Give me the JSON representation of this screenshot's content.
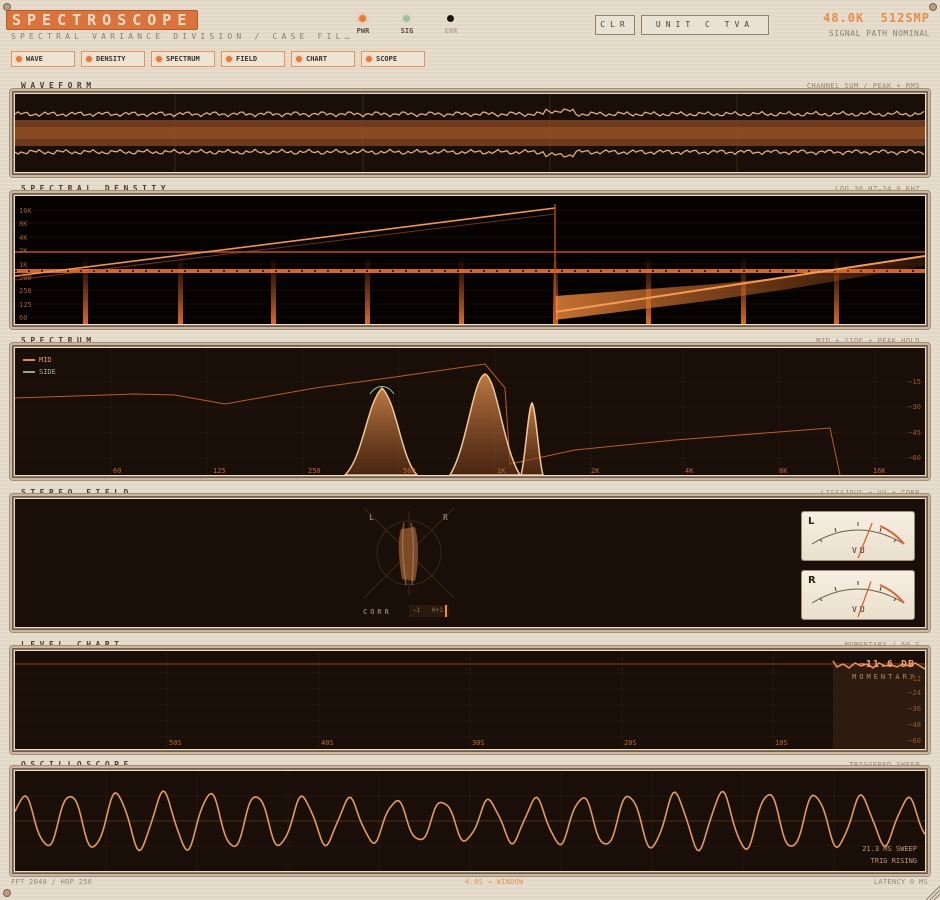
{
  "header": {
    "brand": "SPECTROSCOPE",
    "subtitle": "SPECTRAL VARIANCE DIVISION / CASE FIL…",
    "leds": [
      {
        "label": "PWR",
        "color": "#e87a3c"
      },
      {
        "label": "SIG",
        "color": "#9fc49a"
      },
      {
        "label": "ERR",
        "color": "#1a1410"
      }
    ],
    "clear_label": "CLR",
    "unit_label": "UNIT C TVA",
    "sample_rate": "48.0K",
    "buffer": "512SMP",
    "signal_path": "SIGNAL PATH NOMINAL"
  },
  "tabs": [
    {
      "label": "WAVE"
    },
    {
      "label": "DENSITY"
    },
    {
      "label": "SPECTRUM"
    },
    {
      "label": "FIELD"
    },
    {
      "label": "CHART"
    },
    {
      "label": "SCOPE"
    }
  ],
  "waveform": {
    "title": "WAVEFORM",
    "meta": "CHANNEL SUM / PEAK + RMS"
  },
  "density": {
    "title": "SPECTRAL DENSITY",
    "meta": "LOG 30 HZ–24.0 KHZ",
    "ylabels": [
      "16K",
      "8K",
      "4K",
      "2K",
      "1K",
      "500",
      "250",
      "125",
      "60"
    ]
  },
  "spectrum": {
    "title": "SPECTRUM",
    "meta": "MID + SIDE + PEAK HOLD",
    "legend": [
      {
        "label": "MID",
        "color": "#e08a4c"
      },
      {
        "label": "SIDE",
        "color": "#8fa888"
      }
    ],
    "xlabels": [
      "60",
      "125",
      "250",
      "500",
      "1K",
      "2K",
      "4K",
      "8K",
      "16K"
    ],
    "ylabels": [
      "−15",
      "−30",
      "−45",
      "−60"
    ]
  },
  "field": {
    "title": "STEREO FIELD",
    "meta": "LISSAJOUS + VU + CORR",
    "left": "L",
    "right": "R",
    "corr_label": "CORR",
    "corr_min": "−1",
    "corr_mid": "0+1",
    "corr_value": 0.9,
    "vu_left": {
      "ch": "L",
      "label": "VU",
      "needle": 0.72
    },
    "vu_right": {
      "ch": "R",
      "label": "VU",
      "needle": 0.7
    }
  },
  "chart": {
    "title": "LEVEL CHART",
    "meta": "MOMENTARY / 60 S",
    "reading": "−11.6 DB",
    "reading_label": "MOMENTARY",
    "xlabels": [
      "50S",
      "40S",
      "30S",
      "20S",
      "10S"
    ],
    "ylabels": [
      "−12",
      "−24",
      "−36",
      "−48",
      "−60"
    ]
  },
  "scope": {
    "title": "OSCILLOSCOPE",
    "meta": "TRIGGERED SWEEP",
    "sweep": "21.3 MS SWEEP",
    "trigger": "TRIG RISING"
  },
  "footer": {
    "fft": "FFT 2048 / HOP 256",
    "window": "4.0S → WINDOW",
    "latency": "LATENCY 0 MS"
  }
}
